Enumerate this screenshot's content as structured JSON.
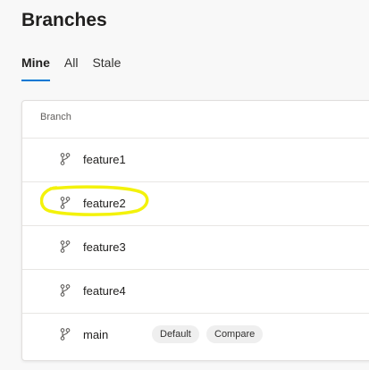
{
  "page": {
    "title": "Branches"
  },
  "tabs": [
    {
      "label": "Mine",
      "active": true
    },
    {
      "label": "All",
      "active": false
    },
    {
      "label": "Stale",
      "active": false
    }
  ],
  "table": {
    "column_header": "Branch",
    "rows": [
      {
        "name": "feature1",
        "icon": "branch-icon"
      },
      {
        "name": "feature2",
        "icon": "branch-icon",
        "highlighted": true
      },
      {
        "name": "feature3",
        "icon": "branch-icon"
      },
      {
        "name": "feature4",
        "icon": "branch-icon"
      },
      {
        "name": "main",
        "icon": "branch-icon",
        "badges": [
          "Default",
          "Compare"
        ]
      }
    ]
  },
  "colors": {
    "accent": "#0078d4",
    "highlight": "#f3f20b"
  }
}
